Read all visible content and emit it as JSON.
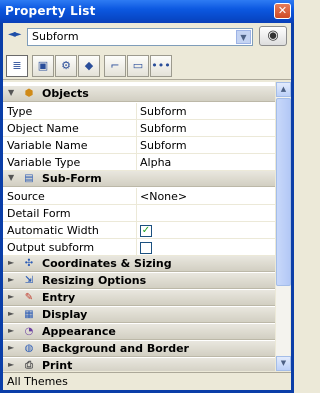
{
  "window": {
    "title": "Property List",
    "close_glyph": "✕"
  },
  "selector": {
    "value": "Subform",
    "dropdown_glyph": "▼",
    "nav_glyph": "◄►",
    "eye_glyph": "◉"
  },
  "toolbar": {
    "tabs": [
      {
        "name": "list-view-icon",
        "glyph": "≣"
      },
      {
        "name": "form-icon",
        "glyph": "▣"
      },
      {
        "name": "gear-icon",
        "glyph": "⚙"
      },
      {
        "name": "shapes-icon",
        "glyph": "◆"
      },
      {
        "name": "chart-icon",
        "glyph": "⌐"
      },
      {
        "name": "monitor-icon",
        "glyph": "▭"
      },
      {
        "name": "more-icon",
        "glyph": "•••"
      }
    ]
  },
  "sections": {
    "objects": {
      "label": "Objects",
      "icon": "cube-icon",
      "glyph": "⬢",
      "expanded": true,
      "rows": [
        {
          "key": "Type",
          "value": "Subform"
        },
        {
          "key": "Object Name",
          "value": "Subform"
        },
        {
          "key": "Variable Name",
          "value": "Subform"
        },
        {
          "key": "Variable Type",
          "value": "Alpha"
        }
      ]
    },
    "subform": {
      "label": "Sub-Form",
      "icon": "subform-icon",
      "glyph": "▤",
      "expanded": true,
      "rows": [
        {
          "key": "Source",
          "value": "<None>"
        },
        {
          "key": "Detail Form",
          "value": ""
        },
        {
          "key": "Automatic Width",
          "checked": true
        },
        {
          "key": "Output subform",
          "checked": false
        }
      ]
    },
    "collapsed": [
      {
        "label": "Coordinates & Sizing",
        "icon": "move-icon",
        "glyph": "✣"
      },
      {
        "label": "Resizing Options",
        "icon": "resize-icon",
        "glyph": "⇲"
      },
      {
        "label": "Entry",
        "icon": "entry-icon",
        "glyph": "✎"
      },
      {
        "label": "Display",
        "icon": "display-icon",
        "glyph": "▦"
      },
      {
        "label": "Appearance",
        "icon": "eye-icon",
        "glyph": "◔"
      },
      {
        "label": "Background and Border",
        "icon": "paint-icon",
        "glyph": "◍"
      },
      {
        "label": "Print",
        "icon": "printer-icon",
        "glyph": "⎙"
      }
    ]
  },
  "status": {
    "text": "All Themes"
  },
  "glyphs": {
    "expanded": "▼",
    "collapsed": "►",
    "check": "✓",
    "scroll_up": "▲",
    "scroll_down": "▼"
  },
  "colors": {
    "title_bar": "#0c58e0",
    "section_bg": "#d9d6ca",
    "accent": "#2a4e9a"
  }
}
